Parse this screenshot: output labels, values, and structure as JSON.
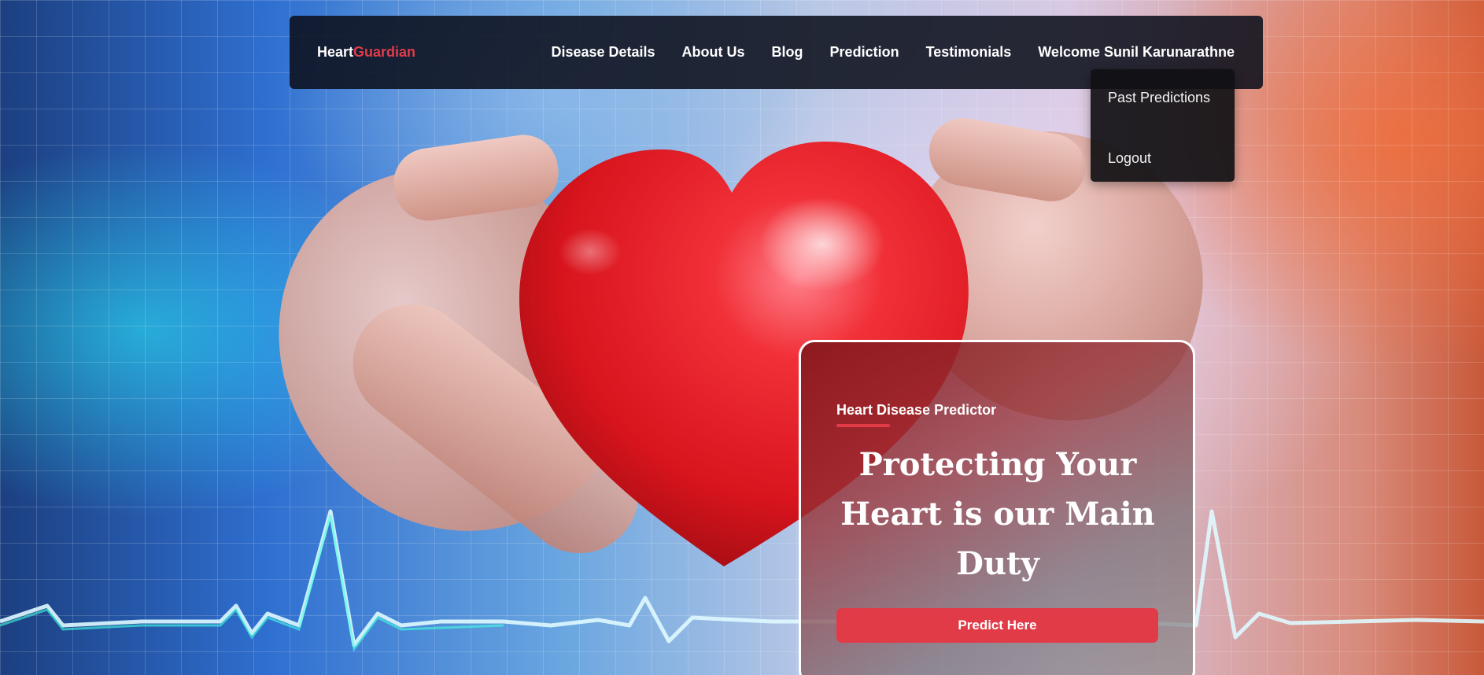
{
  "navbar": {
    "brand_primary": "Heart",
    "brand_accent": "Guardian",
    "links": [
      {
        "label": "Disease Details"
      },
      {
        "label": "About Us"
      },
      {
        "label": "Blog"
      },
      {
        "label": "Prediction"
      },
      {
        "label": "Testimonials"
      }
    ],
    "user_menu_label": "Welcome Sunil Karunarathne"
  },
  "user_dropdown": {
    "items": [
      {
        "label": "Past Predictions"
      },
      {
        "label": "Logout"
      }
    ]
  },
  "hero_card": {
    "eyebrow": "Heart Disease Predictor",
    "heading": "Protecting Your Heart is our Main Duty",
    "cta_label": "Predict Here"
  },
  "colors": {
    "accent": "#e23b48",
    "navbar_bg": "#0c101c",
    "text_light": "#ffffff"
  }
}
